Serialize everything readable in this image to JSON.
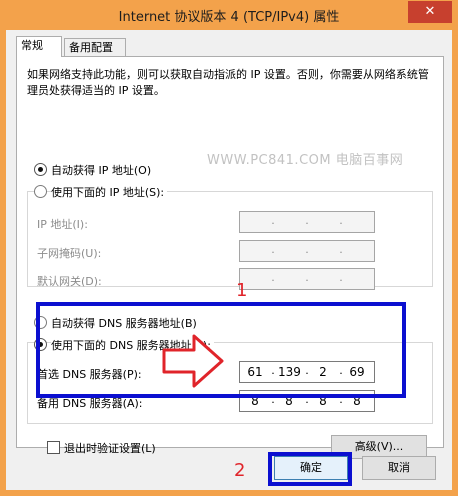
{
  "window": {
    "title": "Internet 协议版本 4 (TCP/IPv4) 属性",
    "close_glyph": "✕"
  },
  "tabs": [
    {
      "label": "常规"
    },
    {
      "label": "备用配置"
    }
  ],
  "description": "如果网络支持此功能，则可以获取自动指派的 IP 设置。否则，你需要从网络系统管理员处获得适当的 IP 设置。",
  "watermark": "WWW.PC841.COM 电脑百事网",
  "ip_options": {
    "auto": {
      "label": "自动获得 IP 地址(O)",
      "selected": true
    },
    "manual": {
      "label": "使用下面的 IP 地址(S):",
      "selected": false
    }
  },
  "ip_fields": [
    {
      "label": "IP 地址(I):",
      "value": [
        " ",
        " ",
        " ",
        " "
      ]
    },
    {
      "label": "子网掩码(U):",
      "value": [
        " ",
        " ",
        " ",
        " "
      ]
    },
    {
      "label": "默认网关(D):",
      "value": [
        " ",
        " ",
        " ",
        " "
      ]
    }
  ],
  "dns_options": {
    "auto": {
      "label": "自动获得 DNS 服务器地址(B)",
      "selected": false
    },
    "manual": {
      "label": "使用下面的 DNS 服务器地址(E):",
      "selected": true
    }
  },
  "dns_fields": [
    {
      "label": "首选 DNS 服务器(P):",
      "value": [
        "61",
        "139",
        "2",
        "69"
      ]
    },
    {
      "label": "备用 DNS 服务器(A):",
      "value": [
        "8",
        "8",
        "8",
        "8"
      ]
    }
  ],
  "validate": {
    "label": "退出时验证设置(L)",
    "checked": false
  },
  "buttons": {
    "advanced": "高级(V)...",
    "ok": "确定",
    "cancel": "取消"
  },
  "annotations": {
    "one": "1",
    "two": "2"
  },
  "colors": {
    "titlebar": "#f3a24b",
    "close": "#c7402e",
    "highlight_box": "#0b0fd0",
    "annotation": "#e0242a"
  }
}
